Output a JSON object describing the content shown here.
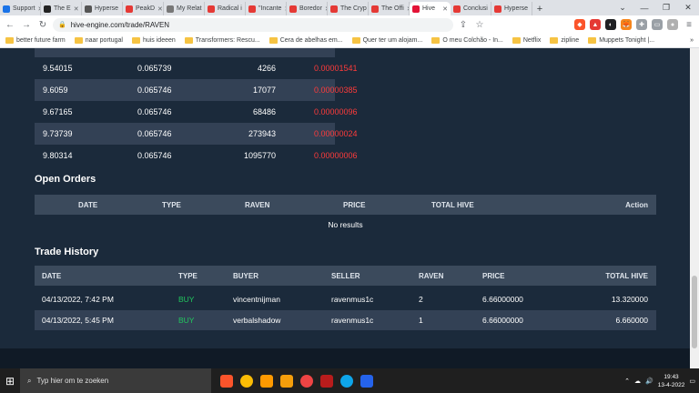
{
  "browser": {
    "tabs": [
      {
        "label": "Support",
        "color": "#1a73e8"
      },
      {
        "label": "The E",
        "color": "#222222"
      },
      {
        "label": "Hyperse",
        "color": "#555555"
      },
      {
        "label": "PeakD",
        "color": "#e53935"
      },
      {
        "label": "My Relat",
        "color": "#777777"
      },
      {
        "label": "Radical i",
        "color": "#e53935"
      },
      {
        "label": "\"Incante",
        "color": "#e53935"
      },
      {
        "label": "Boredor",
        "color": "#e53935"
      },
      {
        "label": "The Cryp",
        "color": "#e53935"
      },
      {
        "label": "The Offi",
        "color": "#e53935"
      },
      {
        "label": "Hive",
        "color": "#e31337"
      },
      {
        "label": "Conclusi",
        "color": "#e53935"
      },
      {
        "label": "Hyperse",
        "color": "#e53935"
      }
    ],
    "new_tab": "+",
    "address": "hive-engine.com/trade/RAVEN",
    "bookmarks": [
      "better future farm",
      "naar portugal",
      "huis ideeen",
      "Transformers: Rescu...",
      "Cera de abelhas em...",
      "Quer ter um alojam...",
      "O meu Colchão - In...",
      "Netflix",
      "zipline",
      "Muppets Tonight |..."
    ],
    "bookmarks_more": "»"
  },
  "orderbook": {
    "rows": [
      {
        "a": "9.54015",
        "b": "0.065739",
        "c": "4266",
        "d": "0.00001541"
      },
      {
        "a": "9.6059",
        "b": "0.065746",
        "c": "17077",
        "d": "0.00000385"
      },
      {
        "a": "9.67165",
        "b": "0.065746",
        "c": "68486",
        "d": "0.00000096"
      },
      {
        "a": "9.73739",
        "b": "0.065746",
        "c": "273943",
        "d": "0.00000024"
      },
      {
        "a": "9.80314",
        "b": "0.065746",
        "c": "1095770",
        "d": "0.00000006"
      }
    ]
  },
  "open_orders": {
    "title": "Open Orders",
    "headers": {
      "date": "DATE",
      "type": "TYPE",
      "raven": "RAVEN",
      "price": "PRICE",
      "total": "TOTAL HIVE",
      "action": "Action"
    },
    "empty": "No results"
  },
  "trade_history": {
    "title": "Trade History",
    "headers": {
      "date": "DATE",
      "type": "TYPE",
      "buyer": "BUYER",
      "seller": "SELLER",
      "raven": "RAVEN",
      "price": "PRICE",
      "total": "TOTAL HIVE"
    },
    "rows": [
      {
        "date": "04/13/2022, 7:42 PM",
        "type": "BUY",
        "buyer": "vincentnijman",
        "seller": "ravenmus1c",
        "raven": "2",
        "price": "6.66000000",
        "total": "13.320000"
      },
      {
        "date": "04/13/2022, 5:45 PM",
        "type": "BUY",
        "buyer": "verbalshadow",
        "seller": "ravenmus1c",
        "raven": "1",
        "price": "6.66000000",
        "total": "6.660000"
      }
    ]
  },
  "taskbar": {
    "search_placeholder": "Typ hier om te zoeken",
    "time": "19:43",
    "date": "13-4-2022"
  },
  "colors": {
    "page_bg": "#1b2a3b",
    "row_alt": "#334155",
    "sell_red": "#ff3b3b",
    "buy_green": "#22c55e"
  }
}
